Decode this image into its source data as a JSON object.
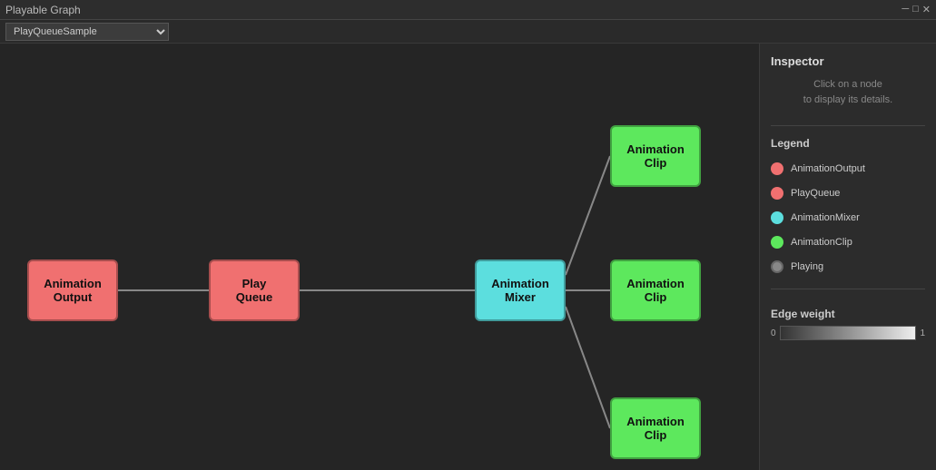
{
  "titleBar": {
    "title": "Playable Graph",
    "controls": [
      "─",
      "□",
      "✕"
    ]
  },
  "toolbar": {
    "dropdown": {
      "value": "PlayQueueSample",
      "options": [
        "PlayQueueSample"
      ]
    }
  },
  "nodes": {
    "animOutput": {
      "label": "Animation\nOutput"
    },
    "playQueue": {
      "label": "Play\nQueue"
    },
    "animMixer": {
      "label": "Animation\nMixer"
    },
    "clipTop": {
      "label": "Animation\nClip"
    },
    "clipMid": {
      "label": "Animation\nClip"
    },
    "clipBot": {
      "label": "Animation\nClip"
    }
  },
  "inspector": {
    "title": "Inspector",
    "hint_line1": "Click on a node",
    "hint_line2": "to display its details."
  },
  "legend": {
    "title": "Legend",
    "items": [
      {
        "label": "AnimationOutput",
        "color": "#f07070"
      },
      {
        "label": "PlayQueue",
        "color": "#f07070"
      },
      {
        "label": "AnimationMixer",
        "color": "#5cdede"
      },
      {
        "label": "AnimationClip",
        "color": "#5de85d"
      },
      {
        "label": "Playing",
        "color": "#888"
      }
    ]
  },
  "edgeWeight": {
    "title": "Edge weight",
    "min": "0",
    "max": "1"
  }
}
